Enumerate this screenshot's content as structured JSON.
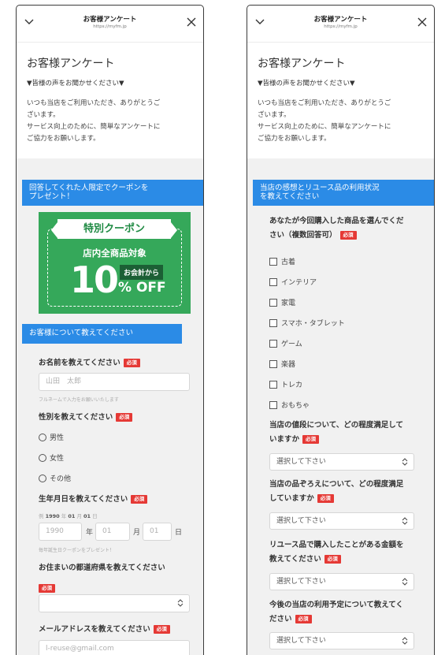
{
  "screens": [
    {
      "topbar": {
        "title": "お客様アンケート",
        "url": "https://myfm.jp"
      },
      "intro": {
        "heading": "お客様アンケート",
        "subheading": "▼皆様の声をお聞かせください▼",
        "body1": "いつも当店をご利用いただき、ありがとうご",
        "body2": "ざいます。",
        "body3": "サービス向上のために、簡単なアンケートに",
        "body4": "ご協力をお願いします。"
      }
    },
    {
      "topbar": {
        "title": "お客様アンケート",
        "url": "https://myfm.jp"
      },
      "intro": {
        "heading": "お客様アンケート",
        "subheading": "▼皆様の声をお聞かせください▼",
        "body1": "いつも当店をご利用いただき、ありがとうご",
        "body2": "ざいます。",
        "body3": "サービス向上のために、簡単なアンケートに",
        "body4": "ご協力をお願いします。"
      }
    }
  ],
  "left": {
    "coupon_banner_line1": "回答してくれた人限定でクーポンを",
    "coupon_banner_line2": "プレゼント！",
    "coupon": {
      "ribbon": "特別クーポン",
      "all_items": "店内全商品対象",
      "from_total": "お会計から",
      "number": "10",
      "off": "% OFF"
    },
    "about_banner": "お客様について教えてください",
    "required": "必須",
    "name_label": "お名前を教えてください",
    "name_placeholder": "山田　太郎",
    "name_hint": "フルネームで入力をお願いいたします",
    "gender_label": "性別を教えてください",
    "gender_options": [
      "男性",
      "女性",
      "その他"
    ],
    "birth_label": "生年月日を教えてください",
    "birth_example_prefix": "例",
    "birth_example_year": "1990",
    "birth_example_month": "01",
    "birth_example_day": "01",
    "year_unit": "年",
    "month_unit": "月",
    "day_unit": "日",
    "birth_year_placeholder": "1990",
    "birth_month_placeholder": "01",
    "birth_day_placeholder": "01",
    "birth_hint": "毎年誕生日クーポンをプレゼント！",
    "pref_label": "お住まいの都道府県を教えてください",
    "email_label": "メールアドレスを教えてください",
    "email_placeholder": "l-reuse@gmail.com"
  },
  "right": {
    "banner_line1": "当店の感想とリユース品の利用状況",
    "banner_line2": "を教えてください",
    "required": "必須",
    "purchase_label_line1": "あなたが今回購入した商品を選んでくだ",
    "purchase_label_line2": "さい（複数回答可）",
    "purchase_options": [
      "古着",
      "インテリア",
      "家電",
      "スマホ・タブレット",
      "ゲーム",
      "楽器",
      "トレカ",
      "おもちゃ"
    ],
    "price_label_line1": "当店の値段について、どの程度満足して",
    "price_label_line2": "いますか",
    "assort_label_line1": "当店の品ぞろえについて、どの程度満足",
    "assort_label_line2": "していますか",
    "amount_label_line1": "リユース品で購入したことがある金額を",
    "amount_label_line2": "教えてください",
    "future_label_line1": "今後の当店の利用予定について教えてく",
    "future_label_line2": "ださい",
    "select_placeholder": "選択して下さい"
  }
}
